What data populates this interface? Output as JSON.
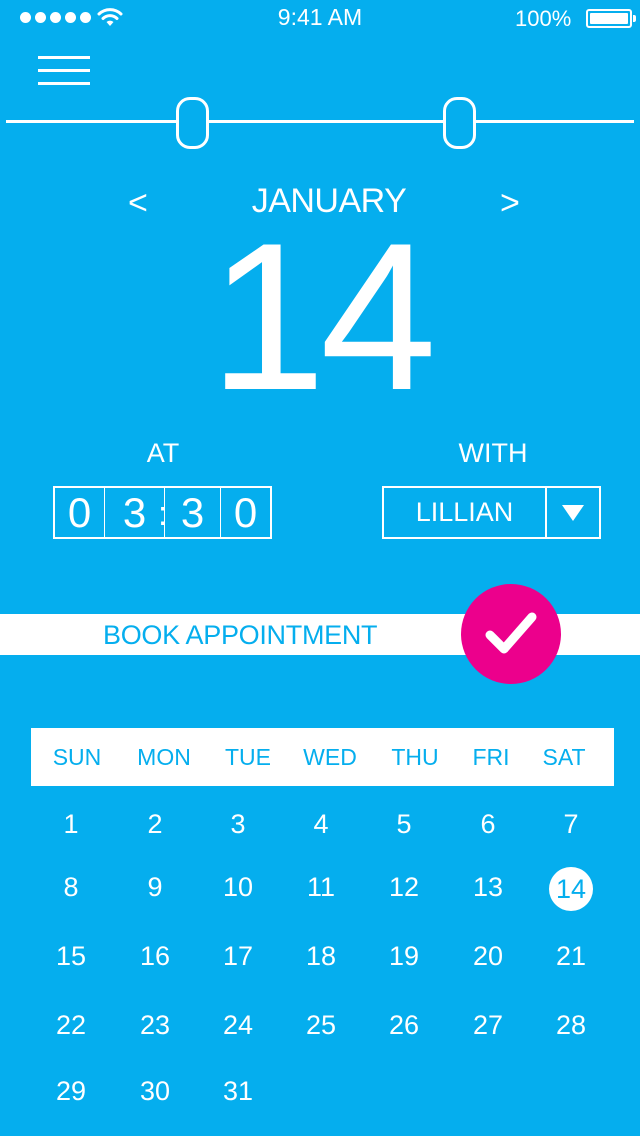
{
  "status_bar": {
    "time": "9:41 AM",
    "battery_percent": "100%",
    "signal_bars": 5,
    "wifi_icon": "wifi-icon",
    "battery_icon": "battery-icon"
  },
  "header": {
    "menu_icon": "hamburger-menu-icon",
    "range_slider": {
      "handles": 2
    }
  },
  "date_nav": {
    "prev_label": "<",
    "next_label": ">",
    "month": "JANUARY",
    "day": "14"
  },
  "booking": {
    "at_label": "AT",
    "with_label": "WITH",
    "time_digits": [
      "0",
      "3",
      "3",
      "0"
    ],
    "time_separator": ":",
    "with_value": "LILLIAN",
    "dropdown_icon": "caret-down-icon",
    "book_label": "BOOK APPOINTMENT",
    "confirm_icon": "checkmark-icon"
  },
  "calendar": {
    "weekdays": [
      "SUN",
      "MON",
      "TUE",
      "WED",
      "THU",
      "FRI",
      "SAT"
    ],
    "selected_date": "14",
    "weeks": [
      [
        "1",
        "2",
        "3",
        "4",
        "5",
        "6",
        "7"
      ],
      [
        "8",
        "9",
        "10",
        "11",
        "12",
        "13",
        "14"
      ],
      [
        "15",
        "16",
        "17",
        "18",
        "19",
        "20",
        "21"
      ],
      [
        "22",
        "23",
        "24",
        "25",
        "26",
        "27",
        "28"
      ],
      [
        "29",
        "30",
        "31"
      ]
    ]
  },
  "colors": {
    "background": "#05aeee",
    "accent": "#ec008c",
    "foreground": "#ffffff"
  }
}
